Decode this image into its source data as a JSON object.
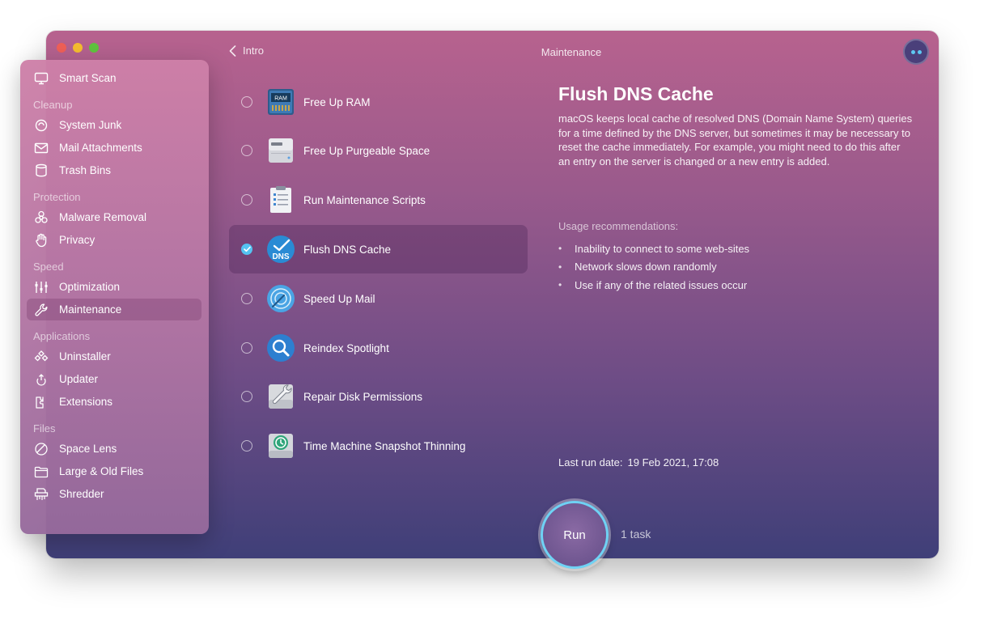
{
  "window": {
    "title": "Maintenance",
    "back_label": "Intro"
  },
  "sidebar": {
    "top_item": {
      "label": "Smart Scan",
      "icon": "monitor-icon"
    },
    "sections": [
      {
        "title": "Cleanup",
        "items": [
          {
            "label": "System Junk",
            "icon": "trash-bin-icon"
          },
          {
            "label": "Mail Attachments",
            "icon": "envelope-icon"
          },
          {
            "label": "Trash Bins",
            "icon": "bin-icon"
          }
        ]
      },
      {
        "title": "Protection",
        "items": [
          {
            "label": "Malware Removal",
            "icon": "biohazard-icon"
          },
          {
            "label": "Privacy",
            "icon": "hand-icon"
          }
        ]
      },
      {
        "title": "Speed",
        "items": [
          {
            "label": "Optimization",
            "icon": "sliders-icon"
          },
          {
            "label": "Maintenance",
            "icon": "wrench-icon",
            "active": true
          }
        ]
      },
      {
        "title": "Applications",
        "items": [
          {
            "label": "Uninstaller",
            "icon": "apps-icon"
          },
          {
            "label": "Updater",
            "icon": "update-icon"
          },
          {
            "label": "Extensions",
            "icon": "puzzle-icon"
          }
        ]
      },
      {
        "title": "Files",
        "items": [
          {
            "label": "Space Lens",
            "icon": "lens-icon"
          },
          {
            "label": "Large & Old Files",
            "icon": "folder-icon"
          },
          {
            "label": "Shredder",
            "icon": "shredder-icon"
          }
        ]
      }
    ]
  },
  "tasks": [
    {
      "label": "Free Up RAM",
      "icon": "ram-icon",
      "icon_text": "RAM",
      "checked": false
    },
    {
      "label": "Free Up Purgeable Space",
      "icon": "disk-icon",
      "checked": false
    },
    {
      "label": "Run Maintenance Scripts",
      "icon": "clipboard-icon",
      "checked": false
    },
    {
      "label": "Flush DNS Cache",
      "icon": "dns-icon",
      "icon_text": "DNS",
      "checked": true
    },
    {
      "label": "Speed Up Mail",
      "icon": "mail-stamp-icon",
      "checked": false
    },
    {
      "label": "Reindex Spotlight",
      "icon": "spotlight-icon",
      "checked": false
    },
    {
      "label": "Repair Disk Permissions",
      "icon": "wrench-disk-icon",
      "checked": false
    },
    {
      "label": "Time Machine Snapshot Thinning",
      "icon": "time-machine-icon",
      "checked": false
    }
  ],
  "detail": {
    "title": "Flush DNS Cache",
    "description": "macOS keeps local cache of resolved DNS (Domain Name System) queries for a time defined by the DNS server, but sometimes it may be necessary to reset the cache immediately. For example, you might need to do this after an entry on the server is changed or a new entry is added.",
    "usage_title": "Usage recommendations:",
    "usage": [
      "Inability to connect to some web-sites",
      "Network slows down randomly",
      "Use if any of the related issues occur"
    ],
    "last_run_label": "Last run date:",
    "last_run_value": "19 Feb 2021, 17:08"
  },
  "run": {
    "label": "Run",
    "count_text": "1 task"
  },
  "colors": {
    "accent": "#54c3f1",
    "run_ring": "#6fd2f4"
  }
}
